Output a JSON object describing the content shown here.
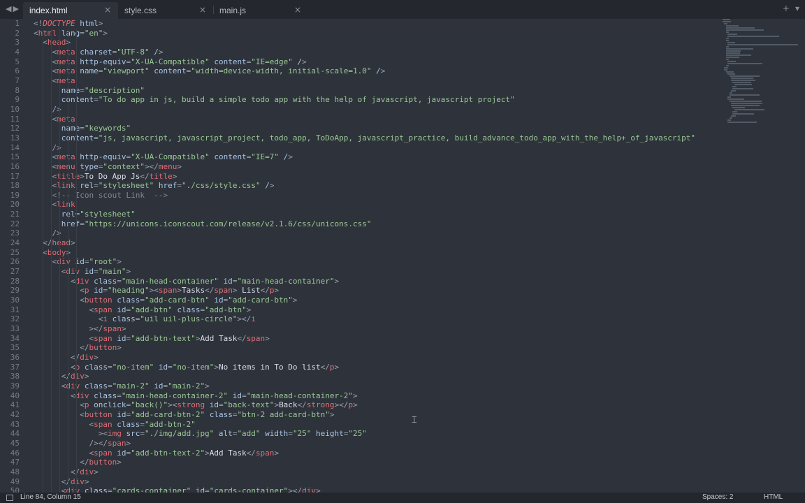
{
  "tabs": [
    {
      "label": "index.html",
      "active": true
    },
    {
      "label": "style.css",
      "active": false
    },
    {
      "label": "main.js",
      "active": false
    }
  ],
  "tab_actions": {
    "new_tab": "+",
    "menu": "▾"
  },
  "nav": {
    "back": "◀",
    "forward": "▶"
  },
  "close_glyph": "×",
  "line_numbers": [
    "1",
    "2",
    "3",
    "4",
    "5",
    "6",
    "7",
    "8",
    "9",
    "10",
    "11",
    "12",
    "13",
    "14",
    "15",
    "16",
    "17",
    "18",
    "19",
    "20",
    "21",
    "22",
    "23",
    "24",
    "25",
    "26",
    "27",
    "28",
    "29",
    "30",
    "31",
    "32",
    "33",
    "34",
    "35",
    "36",
    "37",
    "38",
    "39",
    "40",
    "41",
    "42",
    "43",
    "44",
    "45",
    "46",
    "47",
    "48",
    "49",
    "50"
  ],
  "code_lines": [
    "<!DOCTYPE html>",
    "<html lang=\"en\">",
    "  <head>",
    "    <meta charset=\"UTF-8\" />",
    "    <meta http-equiv=\"X-UA-Compatible\" content=\"IE=edge\" />",
    "    <meta name=\"viewport\" content=\"width=device-width, initial-scale=1.0\" />",
    "    <meta",
    "      name=\"description\"",
    "      content=\"To do app in js, build a simple todo app with the help of javascript, javascript project\"",
    "    />",
    "    <meta",
    "      name=\"keywords\"",
    "      content=\"js, javascript, javascript_project, todo_app, ToDoApp, javascript_practice, build_advance_todo_app_with_the_help+_of_javascript\"",
    "    />",
    "    <meta http-equiv=\"X-UA-Compatible\" content=\"IE=7\" />",
    "    <menu type=\"context\"></menu>",
    "    <title>To Do App Js</title>",
    "    <link rel=\"stylesheet\" href=\"./css/style.css\" />",
    "    <!-- Icon scout Link  -->",
    "    <link",
    "      rel=\"stylesheet\"",
    "      href=\"https://unicons.iconscout.com/release/v2.1.6/css/unicons.css\"",
    "    />",
    "  </head>",
    "  <body>",
    "    <div id=\"root\">",
    "      <div id=\"main\">",
    "        <div class=\"main-head-container\" id=\"main-head-container\">",
    "          <p id=\"heading\"><span>Tasks</span> List</p>",
    "          <button class=\"add-card-btn\" id=\"add-card-btn\">",
    "            <span id=\"add-btn\" class=\"add-btn\">",
    "              <i class=\"uil uil-plus-circle\"></i",
    "            ></span>",
    "            <span id=\"add-btn-text\">Add Task</span>",
    "          </button>",
    "        </div>",
    "        <p class=\"no-item\" id=\"no-item\">No items in To Do list</p>",
    "      </div>",
    "      <div class=\"main-2\" id=\"main-2\">",
    "        <div class=\"main-head-container-2\" id=\"main-head-container-2\">",
    "          <p onclick=\"back()\"><strong id=\"back-text\">Back</strong></p>",
    "          <button id=\"add-card-btn-2\" class=\"btn-2 add-card-btn\">",
    "            <span class=\"add-btn-2\"",
    "              ><img src=\"./img/add.jpg\" alt=\"add\" width=\"25\" height=\"25\"",
    "            /></span>",
    "            <span id=\"add-btn-text-2\">Add Task</span>",
    "          </button>",
    "        </div>",
    "      </div>",
    "      <div class=\"cards-container\" id=\"cards-container\"></div>"
  ],
  "status": {
    "position": "Line 84, Column 15",
    "spaces": "Spaces: 2",
    "syntax": "HTML"
  }
}
